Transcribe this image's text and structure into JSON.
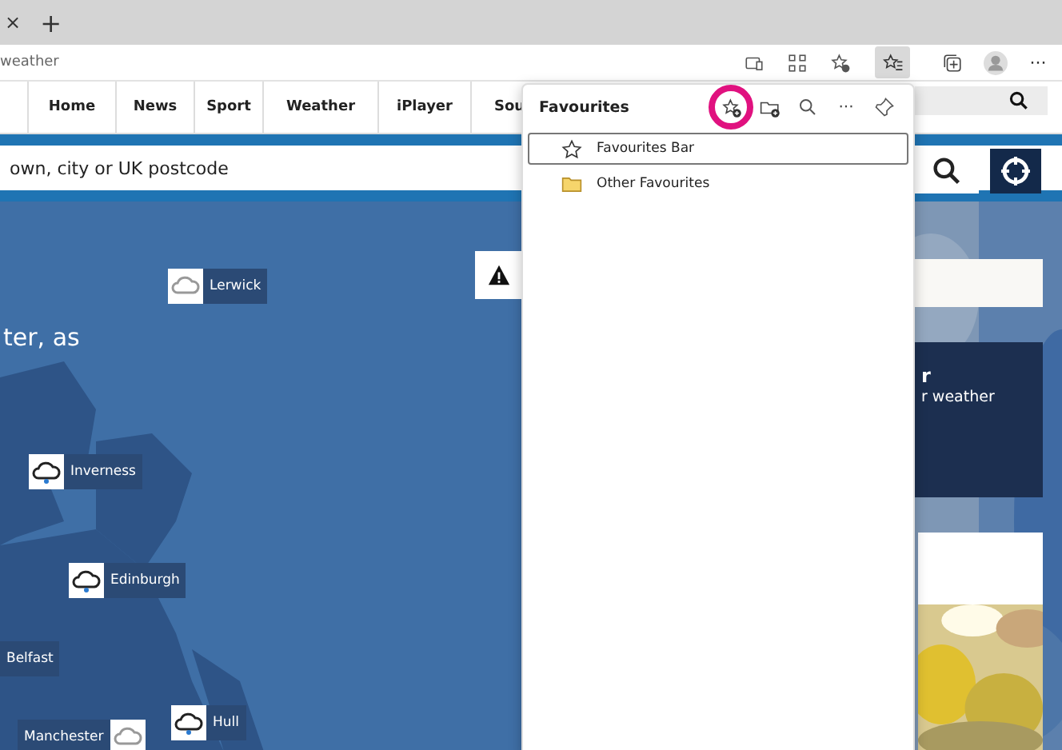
{
  "browser": {
    "tab_close": "×",
    "new_tab": "+",
    "address": "weather",
    "toolbar_buttons": [
      {
        "kind": "screen",
        "selected": false
      },
      {
        "kind": "apps",
        "selected": false
      },
      {
        "kind": "star-add",
        "selected": false
      },
      {
        "kind": "favourites",
        "selected": true
      },
      {
        "kind": "collections",
        "selected": false
      },
      {
        "kind": "profile",
        "selected": false
      },
      {
        "kind": "more",
        "selected": false
      }
    ],
    "more_label": "···"
  },
  "site": {
    "nav": [
      "Home",
      "News",
      "Sport",
      "Weather",
      "iPlayer",
      "Sou"
    ],
    "search": {
      "placeholder": "own, city or UK postcode"
    },
    "hero_text": "ter, as",
    "promo": {
      "title": "r",
      "text": "r weather"
    },
    "map_labels": [
      {
        "name": "Lerwick",
        "kind": "cloud"
      },
      {
        "name": "Inverness",
        "kind": "rain"
      },
      {
        "name": "Edinburgh",
        "kind": "rain"
      },
      {
        "name": "Belfast",
        "kind": "none"
      },
      {
        "name": "Hull",
        "kind": "rain"
      },
      {
        "name": "Manchester",
        "kind": "cloud"
      }
    ]
  },
  "favourites_panel": {
    "title": "Favourites",
    "tools": [
      {
        "kind": "add-favourite",
        "highlighted": true
      },
      {
        "kind": "add-folder",
        "highlighted": false
      },
      {
        "kind": "search",
        "highlighted": false
      },
      {
        "kind": "more",
        "highlighted": false
      },
      {
        "kind": "pin",
        "highlighted": false
      }
    ],
    "more_label": "···",
    "items": [
      {
        "label": "Favourites Bar",
        "kind": "bar",
        "selected": true
      },
      {
        "label": "Other Favourites",
        "kind": "folder",
        "selected": false
      }
    ]
  }
}
